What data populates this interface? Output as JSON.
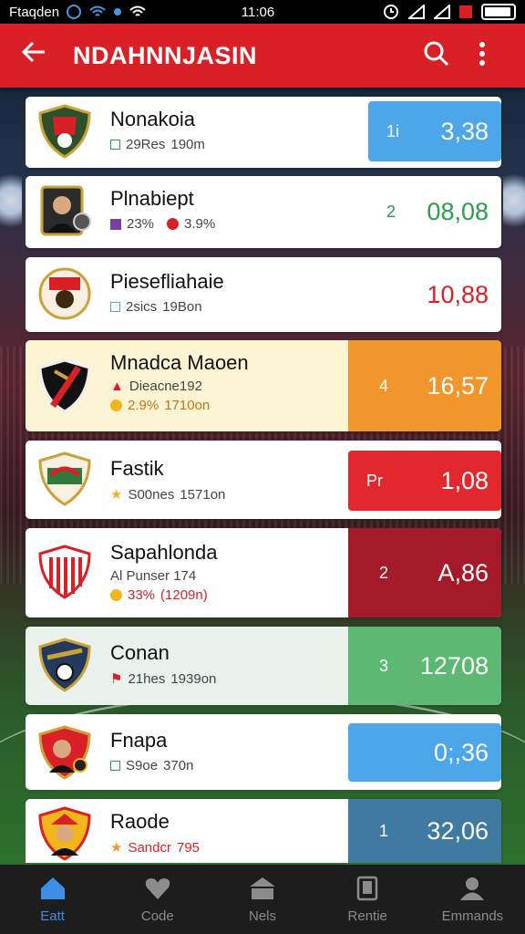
{
  "statusbar": {
    "carrier": "Ftaqden",
    "time": "11:06"
  },
  "appbar": {
    "title": "NDAHNNJASIN"
  },
  "teams": [
    {
      "name": "Nonakoia",
      "stat_a": "29Res",
      "stat_b": "190m",
      "rank": "1i",
      "value": "3,38",
      "score_bg": "#4da6e8",
      "score_fg": "#ffffff",
      "row_bg": "#ffffff",
      "dot_color": "#2a9d4a"
    },
    {
      "name": "Plnabiept",
      "stat_a": "23%",
      "stat_b": "3.9%",
      "rank": "2",
      "value": "08,08",
      "score_bg": "transparent",
      "score_fg": "#2a9d4a",
      "row_bg": "#ffffff",
      "dot_color": "#d92027"
    },
    {
      "name": "Piesefliahaie",
      "stat_a": "2sics",
      "stat_b": "19Bon",
      "rank": "",
      "value": "10,88",
      "score_bg": "transparent",
      "score_fg": "#d92027",
      "row_bg": "#ffffff",
      "dot_color": "#4da6e8"
    },
    {
      "name": "Mnadca Maoen",
      "sub": "Dieacne192",
      "stat_a": "2.9%",
      "stat_b": "1710on",
      "rank": "4",
      "value": "16,57",
      "score_bg": "#f0962c",
      "score_fg": "#ffffff",
      "row_bg": "#fdf4d4",
      "dot_color": "#f2b51c"
    },
    {
      "name": "Fastik",
      "stat_a": "S00nes",
      "stat_b": "1571on",
      "rank": "Pr",
      "value": "1,08",
      "score_bg": "#e0282e",
      "score_fg": "#ffffff",
      "row_bg": "#ffffff",
      "dot_color": "#f2b51c"
    },
    {
      "name": "Sapahlonda",
      "sub": "Al Punser 174",
      "stat_a": "33%",
      "stat_b": "(1209n)",
      "rank": "2",
      "value": "A,86",
      "score_bg": "#a51a2b",
      "score_fg": "#ffffff",
      "row_bg": "#ffffff",
      "dot_color": "#f2b51c"
    },
    {
      "name": "Conan",
      "stat_a": "21hes",
      "stat_b": "1939on",
      "rank": "3",
      "value": "12708",
      "score_bg": "#5cb873",
      "score_fg": "#ffffff",
      "row_bg": "#e8f1ec",
      "dot_color": "#d92027"
    },
    {
      "name": "Fnapa",
      "stat_a": "S9oe",
      "stat_b": "370n",
      "rank": "",
      "value": "0;,36",
      "score_bg": "#4da6e8",
      "score_fg": "#ffffff",
      "row_bg": "#ffffff",
      "dot_color": "#2a9d4a"
    },
    {
      "name": "Raode",
      "stat_a": "Sandcr",
      "stat_b": "795",
      "rank": "1",
      "value": "32,06",
      "score_bg": "#3f7aa0",
      "score_fg": "#ffffff",
      "row_bg": "#ffffff",
      "dot_color": "#f2b51c"
    }
  ],
  "nav": [
    {
      "label": "Eatt",
      "icon": "home-icon",
      "active": true
    },
    {
      "label": "Code",
      "icon": "heart-icon",
      "active": false
    },
    {
      "label": "Nels",
      "icon": "stadium-icon",
      "active": false
    },
    {
      "label": "Rentie",
      "icon": "phone-icon",
      "active": false
    },
    {
      "label": "Emmands",
      "icon": "person-icon",
      "active": false
    }
  ],
  "colors": {
    "primary": "#d92027",
    "nav_active": "#3d8fe6"
  }
}
